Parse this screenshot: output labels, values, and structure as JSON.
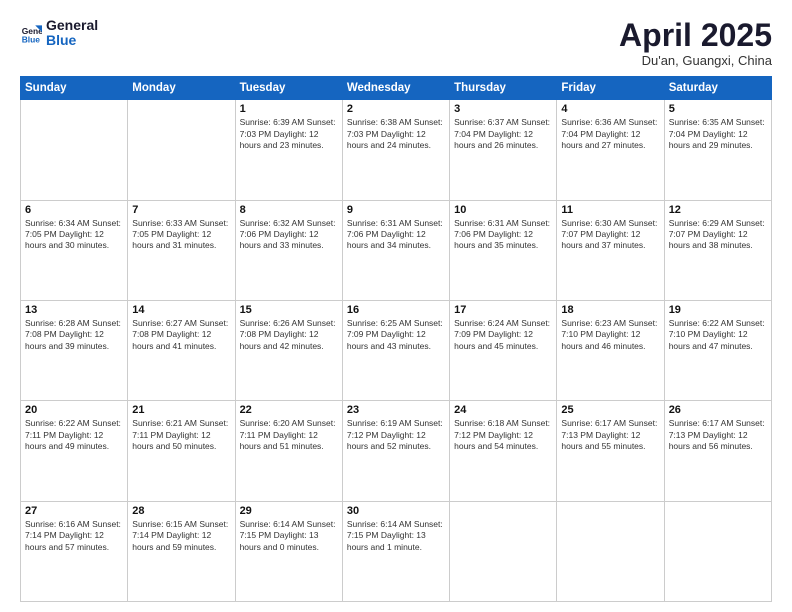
{
  "header": {
    "logo_general": "General",
    "logo_blue": "Blue",
    "month_year": "April 2025",
    "location": "Du'an, Guangxi, China"
  },
  "weekdays": [
    "Sunday",
    "Monday",
    "Tuesday",
    "Wednesday",
    "Thursday",
    "Friday",
    "Saturday"
  ],
  "weeks": [
    [
      {
        "day": "",
        "info": ""
      },
      {
        "day": "",
        "info": ""
      },
      {
        "day": "1",
        "info": "Sunrise: 6:39 AM\nSunset: 7:03 PM\nDaylight: 12 hours and 23 minutes."
      },
      {
        "day": "2",
        "info": "Sunrise: 6:38 AM\nSunset: 7:03 PM\nDaylight: 12 hours and 24 minutes."
      },
      {
        "day": "3",
        "info": "Sunrise: 6:37 AM\nSunset: 7:04 PM\nDaylight: 12 hours and 26 minutes."
      },
      {
        "day": "4",
        "info": "Sunrise: 6:36 AM\nSunset: 7:04 PM\nDaylight: 12 hours and 27 minutes."
      },
      {
        "day": "5",
        "info": "Sunrise: 6:35 AM\nSunset: 7:04 PM\nDaylight: 12 hours and 29 minutes."
      }
    ],
    [
      {
        "day": "6",
        "info": "Sunrise: 6:34 AM\nSunset: 7:05 PM\nDaylight: 12 hours and 30 minutes."
      },
      {
        "day": "7",
        "info": "Sunrise: 6:33 AM\nSunset: 7:05 PM\nDaylight: 12 hours and 31 minutes."
      },
      {
        "day": "8",
        "info": "Sunrise: 6:32 AM\nSunset: 7:06 PM\nDaylight: 12 hours and 33 minutes."
      },
      {
        "day": "9",
        "info": "Sunrise: 6:31 AM\nSunset: 7:06 PM\nDaylight: 12 hours and 34 minutes."
      },
      {
        "day": "10",
        "info": "Sunrise: 6:31 AM\nSunset: 7:06 PM\nDaylight: 12 hours and 35 minutes."
      },
      {
        "day": "11",
        "info": "Sunrise: 6:30 AM\nSunset: 7:07 PM\nDaylight: 12 hours and 37 minutes."
      },
      {
        "day": "12",
        "info": "Sunrise: 6:29 AM\nSunset: 7:07 PM\nDaylight: 12 hours and 38 minutes."
      }
    ],
    [
      {
        "day": "13",
        "info": "Sunrise: 6:28 AM\nSunset: 7:08 PM\nDaylight: 12 hours and 39 minutes."
      },
      {
        "day": "14",
        "info": "Sunrise: 6:27 AM\nSunset: 7:08 PM\nDaylight: 12 hours and 41 minutes."
      },
      {
        "day": "15",
        "info": "Sunrise: 6:26 AM\nSunset: 7:08 PM\nDaylight: 12 hours and 42 minutes."
      },
      {
        "day": "16",
        "info": "Sunrise: 6:25 AM\nSunset: 7:09 PM\nDaylight: 12 hours and 43 minutes."
      },
      {
        "day": "17",
        "info": "Sunrise: 6:24 AM\nSunset: 7:09 PM\nDaylight: 12 hours and 45 minutes."
      },
      {
        "day": "18",
        "info": "Sunrise: 6:23 AM\nSunset: 7:10 PM\nDaylight: 12 hours and 46 minutes."
      },
      {
        "day": "19",
        "info": "Sunrise: 6:22 AM\nSunset: 7:10 PM\nDaylight: 12 hours and 47 minutes."
      }
    ],
    [
      {
        "day": "20",
        "info": "Sunrise: 6:22 AM\nSunset: 7:11 PM\nDaylight: 12 hours and 49 minutes."
      },
      {
        "day": "21",
        "info": "Sunrise: 6:21 AM\nSunset: 7:11 PM\nDaylight: 12 hours and 50 minutes."
      },
      {
        "day": "22",
        "info": "Sunrise: 6:20 AM\nSunset: 7:11 PM\nDaylight: 12 hours and 51 minutes."
      },
      {
        "day": "23",
        "info": "Sunrise: 6:19 AM\nSunset: 7:12 PM\nDaylight: 12 hours and 52 minutes."
      },
      {
        "day": "24",
        "info": "Sunrise: 6:18 AM\nSunset: 7:12 PM\nDaylight: 12 hours and 54 minutes."
      },
      {
        "day": "25",
        "info": "Sunrise: 6:17 AM\nSunset: 7:13 PM\nDaylight: 12 hours and 55 minutes."
      },
      {
        "day": "26",
        "info": "Sunrise: 6:17 AM\nSunset: 7:13 PM\nDaylight: 12 hours and 56 minutes."
      }
    ],
    [
      {
        "day": "27",
        "info": "Sunrise: 6:16 AM\nSunset: 7:14 PM\nDaylight: 12 hours and 57 minutes."
      },
      {
        "day": "28",
        "info": "Sunrise: 6:15 AM\nSunset: 7:14 PM\nDaylight: 12 hours and 59 minutes."
      },
      {
        "day": "29",
        "info": "Sunrise: 6:14 AM\nSunset: 7:15 PM\nDaylight: 13 hours and 0 minutes."
      },
      {
        "day": "30",
        "info": "Sunrise: 6:14 AM\nSunset: 7:15 PM\nDaylight: 13 hours and 1 minute."
      },
      {
        "day": "",
        "info": ""
      },
      {
        "day": "",
        "info": ""
      },
      {
        "day": "",
        "info": ""
      }
    ]
  ]
}
